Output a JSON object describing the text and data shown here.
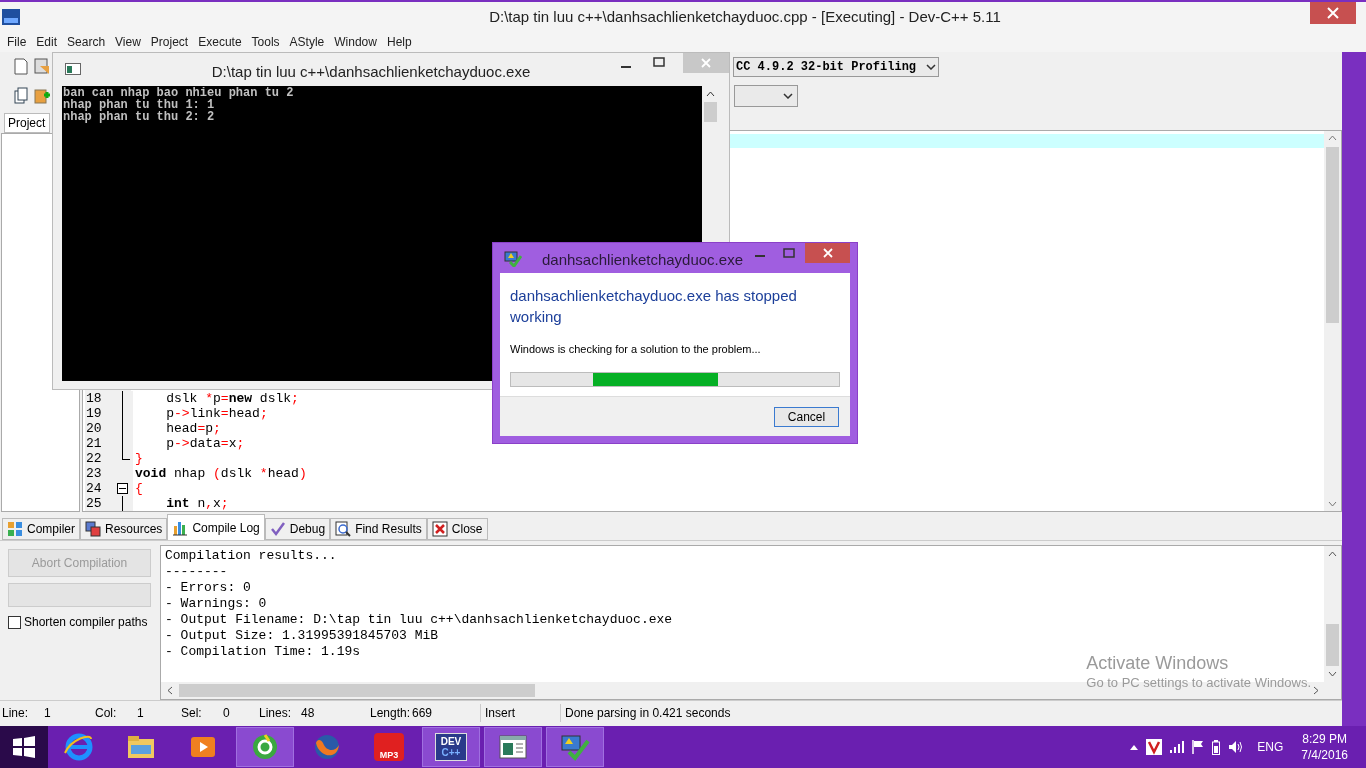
{
  "window": {
    "title": "D:\\tap tin luu c++\\danhsachlienketchayduoc.cpp - [Executing] - Dev-C++ 5.11"
  },
  "menu": [
    "File",
    "Edit",
    "Search",
    "View",
    "Project",
    "Execute",
    "Tools",
    "AStyle",
    "Window",
    "Help"
  ],
  "toolbar": {
    "compiler_select": "CC 4.9.2 32-bit Profiling"
  },
  "project_panel": {
    "tab": "Project"
  },
  "editor": {
    "lines": [
      {
        "number": "18",
        "kind": "line",
        "tokens": [
          {
            "kind": "text",
            "text": "    dslk "
          },
          {
            "kind": "symbol",
            "text": "*"
          },
          {
            "kind": "text",
            "text": "p"
          },
          {
            "kind": "symbol",
            "text": "="
          },
          {
            "kind": "keyword",
            "text": "new"
          },
          {
            "kind": "text",
            "text": " dslk"
          },
          {
            "kind": "symbol",
            "text": ";"
          }
        ]
      },
      {
        "number": "19",
        "kind": "line",
        "tokens": [
          {
            "kind": "text",
            "text": "    p"
          },
          {
            "kind": "symbol",
            "text": "->"
          },
          {
            "kind": "text",
            "text": "link"
          },
          {
            "kind": "symbol",
            "text": "="
          },
          {
            "kind": "text",
            "text": "head"
          },
          {
            "kind": "symbol",
            "text": ";"
          }
        ]
      },
      {
        "number": "20",
        "kind": "line",
        "tokens": [
          {
            "kind": "text",
            "text": "    head"
          },
          {
            "kind": "symbol",
            "text": "="
          },
          {
            "kind": "text",
            "text": "p"
          },
          {
            "kind": "symbol",
            "text": ";"
          }
        ]
      },
      {
        "number": "21",
        "kind": "line",
        "tokens": [
          {
            "kind": "text",
            "text": "    p"
          },
          {
            "kind": "symbol",
            "text": "->"
          },
          {
            "kind": "text",
            "text": "data"
          },
          {
            "kind": "symbol",
            "text": "="
          },
          {
            "kind": "text",
            "text": "x"
          },
          {
            "kind": "symbol",
            "text": ";"
          }
        ]
      },
      {
        "number": "22",
        "kind": "end",
        "tokens": [
          {
            "kind": "symbol",
            "text": "}"
          }
        ]
      },
      {
        "number": "23",
        "kind": "plain",
        "tokens": [
          {
            "kind": "keyword",
            "text": "void"
          },
          {
            "kind": "text",
            "text": " nhap "
          },
          {
            "kind": "symbol",
            "text": "("
          },
          {
            "kind": "text",
            "text": "dslk "
          },
          {
            "kind": "symbol",
            "text": "*"
          },
          {
            "kind": "text",
            "text": "head"
          },
          {
            "kind": "symbol",
            "text": ")"
          }
        ]
      },
      {
        "number": "24",
        "kind": "open",
        "tokens": [
          {
            "kind": "symbol",
            "text": "{"
          }
        ]
      },
      {
        "number": "25",
        "kind": "line",
        "tokens": [
          {
            "kind": "keyword",
            "text": "    int"
          },
          {
            "kind": "text",
            "text": " n"
          },
          {
            "kind": "symbol",
            "text": ","
          },
          {
            "kind": "text",
            "text": "x"
          },
          {
            "kind": "symbol",
            "text": ";"
          }
        ]
      }
    ]
  },
  "bottom_tabs": [
    {
      "label": "Compiler",
      "selected": false
    },
    {
      "label": "Resources",
      "selected": false
    },
    {
      "label": "Compile Log",
      "selected": true
    },
    {
      "label": "Debug",
      "selected": false
    },
    {
      "label": "Find Results",
      "selected": false
    },
    {
      "label": "Close",
      "selected": false
    }
  ],
  "compile_panel": {
    "abort_button": {
      "label": "Abort Compilation",
      "disabled": true
    },
    "progress": {
      "level": 0
    },
    "shorten_paths": {
      "label": "Shorten compiler paths",
      "checked": false
    },
    "log": [
      "Compilation results...",
      "--------",
      "- Errors: 0",
      "- Warnings: 0",
      "- Output Filename: D:\\tap tin luu c++\\danhsachlienketchayduoc.exe",
      "- Output Size: 1.31995391845703 MiB",
      "- Compilation Time: 1.19s"
    ]
  },
  "activation_notice": {
    "title": "Activate Windows",
    "text": "Go to PC settings to activate Windows."
  },
  "status_bar": [
    {
      "label": "Line:",
      "value": "1"
    },
    {
      "label": "Col:",
      "value": "1"
    },
    {
      "label": "Sel:",
      "value": "0"
    },
    {
      "label": "Lines:",
      "value": "48"
    },
    {
      "label": "Length:",
      "value": "669"
    }
  ],
  "status_mode": "Insert",
  "status_message": "Done parsing in 0.421 seconds",
  "console": {
    "title": "D:\\tap tin luu c++\\danhsachlienketchayduoc.exe",
    "output": [
      "ban can nhap bao nhieu phan tu 2",
      "nhap phan tu thu 1: 1",
      "nhap phan tu thu 2: 2"
    ]
  },
  "error_dialog": {
    "title": "danhsachlienketchayduoc.exe",
    "heading": "danhsachlienketchayduoc.exe has stopped working",
    "message": "Windows is checking for a solution to the problem...",
    "progress": {
      "level": 0.38
    },
    "button": "Cancel"
  },
  "taskbar": {
    "apps": [
      {
        "kind": "ie",
        "running": false
      },
      {
        "kind": "explorer",
        "running": false
      },
      {
        "kind": "media",
        "running": false
      },
      {
        "kind": "browser",
        "running": true
      },
      {
        "kind": "firefox",
        "running": false
      },
      {
        "kind": "mp3",
        "label": "MP3",
        "running": false
      },
      {
        "kind": "dev",
        "label": "DEV",
        "sublabel": "C++",
        "running": true
      },
      {
        "kind": "console",
        "running": true
      },
      {
        "kind": "report",
        "running": true
      }
    ],
    "tray": {
      "language": "ENG",
      "time": "8:29 PM",
      "date": "7/4/2016"
    }
  }
}
